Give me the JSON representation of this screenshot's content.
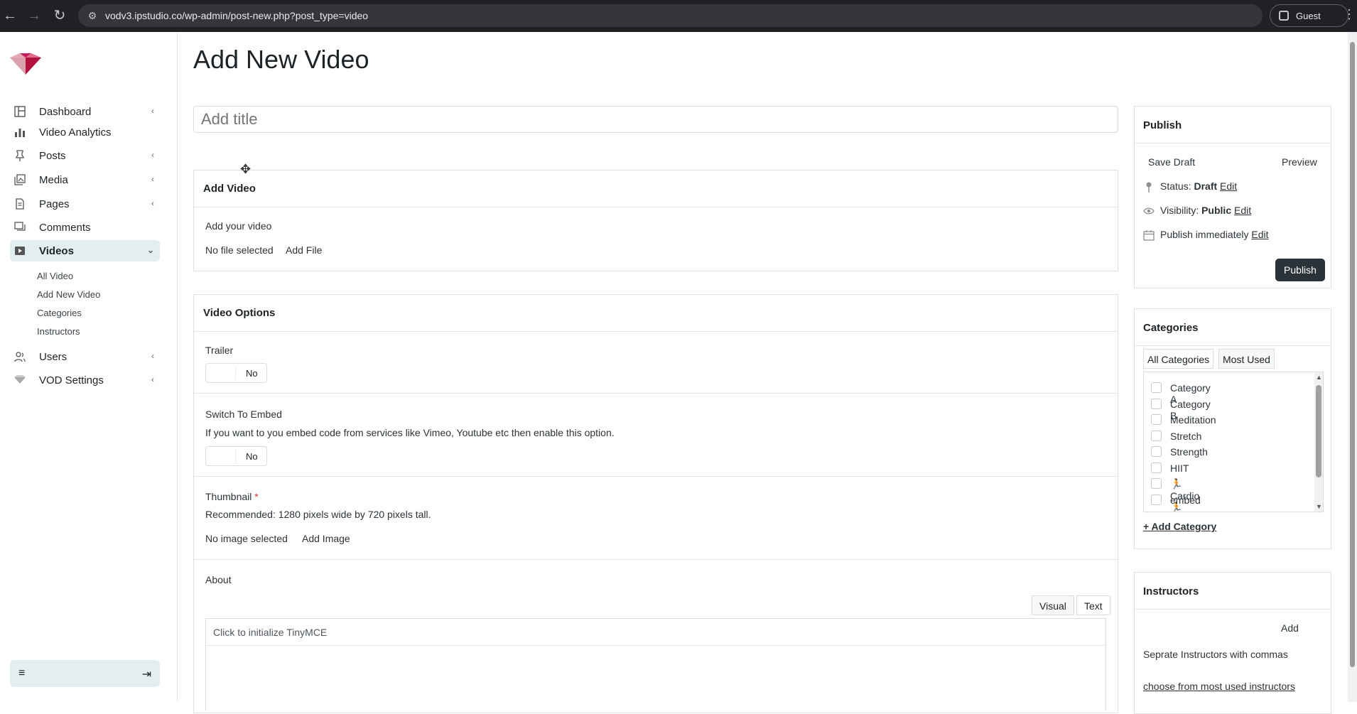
{
  "browser": {
    "url": "vodv3.ipstudio.co/wp-admin/post-new.php?post_type=video",
    "profile_label": "Guest"
  },
  "sidebar": {
    "items": [
      {
        "label": "Dashboard",
        "icon": "dashboard-icon",
        "chevron": "‹"
      },
      {
        "label": "Video Analytics",
        "icon": "bar-chart-icon",
        "chevron": ""
      },
      {
        "label": "Posts",
        "icon": "pin-icon",
        "chevron": "‹"
      },
      {
        "label": "Media",
        "icon": "media-icon",
        "chevron": "‹"
      },
      {
        "label": "Pages",
        "icon": "page-icon",
        "chevron": "‹"
      },
      {
        "label": "Comments",
        "icon": "comments-icon",
        "chevron": ""
      },
      {
        "label": "Videos",
        "icon": "video-icon",
        "chevron": "⌄"
      },
      {
        "label": "Users",
        "icon": "users-icon",
        "chevron": "‹"
      },
      {
        "label": "VOD Settings",
        "icon": "logo-icon",
        "chevron": "‹"
      }
    ],
    "sub_items": [
      "All Video",
      "Add New Video",
      "Categories",
      "Instructors"
    ]
  },
  "main": {
    "page_title": "Add New Video",
    "title_placeholder": "Add title",
    "add_video_box": {
      "heading": "Add Video",
      "label": "Add your video",
      "status": "No file selected",
      "action": "Add File"
    },
    "options_box": {
      "heading": "Video Options",
      "trailer_label": "Trailer",
      "trailer_value": "No",
      "embed_label": "Switch To Embed",
      "embed_desc": "If you want to you embed code from services like Vimeo, Youtube etc then enable this option.",
      "embed_value": "No",
      "thumb_label": "Thumbnail",
      "thumb_required": "*",
      "thumb_desc": "Recommended: 1280 pixels wide by 720 pixels tall.",
      "thumb_status": "No image selected",
      "thumb_action": "Add Image",
      "about_label": "About",
      "tab_visual": "Visual",
      "tab_text": "Text",
      "editor_hint": "Click to initialize TinyMCE"
    }
  },
  "publish": {
    "heading": "Publish",
    "save_draft": "Save Draft",
    "preview": "Preview",
    "status_label": "Status:",
    "status_value": "Draft",
    "visibility_label": "Visibility:",
    "visibility_value": "Public",
    "publish_label": "Publish immediately",
    "edit": "Edit",
    "publish_button": "Publish"
  },
  "categories": {
    "heading": "Categories",
    "tab_all": "All Categories",
    "tab_most": "Most Used",
    "items": [
      "Category A",
      "Category B",
      "Meditation",
      "Stretch",
      "Strength",
      "HIIT",
      "🏃 Cardio 🏃",
      "embed"
    ],
    "add_link": "+ Add Category"
  },
  "instructors": {
    "heading": "Instructors",
    "add_button": "Add",
    "hint": "Seprate Instructors with commas",
    "most_used_link": "choose from most used instructors"
  }
}
